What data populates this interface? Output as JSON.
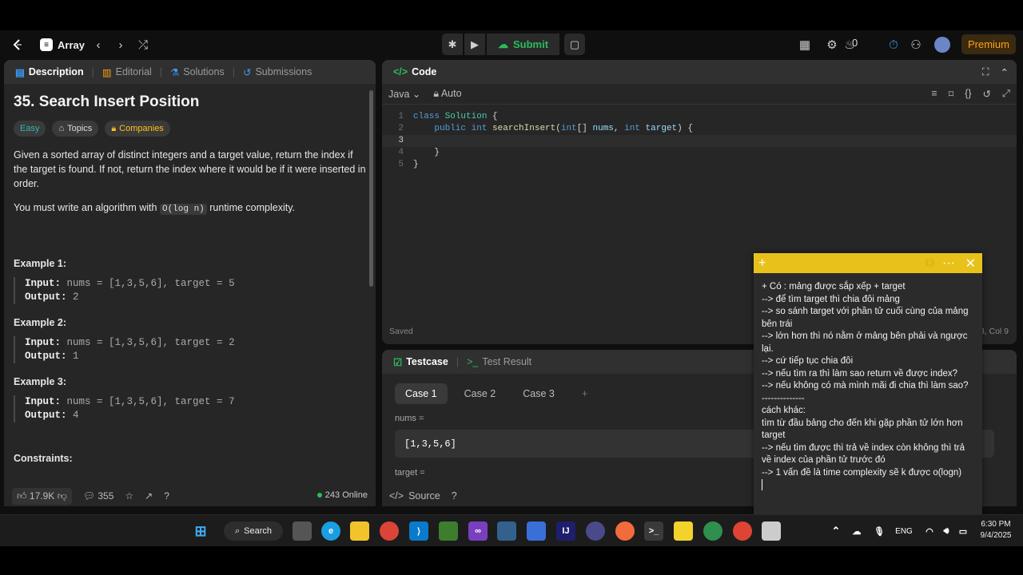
{
  "nav": {
    "problem_list": "Array",
    "submit_label": "Submit",
    "streak_count": "0",
    "premium_label": "Premium"
  },
  "description_panel": {
    "tabs": [
      "Description",
      "Editorial",
      "Solutions",
      "Submissions"
    ],
    "title": "35. Search Insert Position",
    "chips": {
      "difficulty": "Easy",
      "topics": "Topics",
      "companies": "Companies"
    },
    "paragraph1": "Given a sorted array of distinct integers and a target value, return the index if the target is found. If not, return the index where it would be if it were inserted in order.",
    "paragraph2_prefix": "You must write an algorithm with",
    "paragraph2_code": "O(log n)",
    "paragraph2_suffix": "runtime complexity.",
    "examples": [
      {
        "heading": "Example 1:",
        "input_label": "Input:",
        "input": "nums = [1,3,5,6], target = 5",
        "output_label": "Output:",
        "output": "2"
      },
      {
        "heading": "Example 2:",
        "input_label": "Input:",
        "input": "nums = [1,3,5,6], target = 2",
        "output_label": "Output:",
        "output": "1"
      },
      {
        "heading": "Example 3:",
        "input_label": "Input:",
        "input": "nums = [1,3,5,6], target = 7",
        "output_label": "Output:",
        "output": "4"
      }
    ],
    "constraints_heading": "Constraints:",
    "footer": {
      "likes": "17.9K",
      "comments": "355",
      "online": "243 Online"
    }
  },
  "code_panel": {
    "title": "Code",
    "language": "Java",
    "mode": "Auto",
    "lines": [
      "1",
      "2",
      "3",
      "4",
      "5"
    ],
    "status": "Saved",
    "cursor": "3, Col 9"
  },
  "testcase_panel": {
    "tabs": [
      "Testcase",
      "Test Result"
    ],
    "cases": [
      "Case 1",
      "Case 2",
      "Case 3"
    ],
    "fields": [
      {
        "label": "nums =",
        "value": "[1,3,5,6]"
      },
      {
        "label": "target =",
        "value": ""
      }
    ],
    "footer_source": "Source"
  },
  "sticky_note": {
    "lines": [
      "+ Có : mảng được sắp xếp + target",
      "--> để tìm target thì chia đôi mảng",
      "--> so sánh target với phần tử cuối cùng của mảng bên trái",
      "--> lớn hơn thì nó nằm ở mảng bên phải và ngược lại.",
      "--> cứ tiếp tục chia đôi",
      "--> nếu tìm ra thì làm sao return về được index?",
      "--> nếu không có mà mình mãi đi chia thì làm sao?",
      "--------------",
      "cách khác:",
      "tìm từ đầu bảng cho đến khi gặp phần tử lớn hơn target",
      "--> nếu tìm được thì trả về index còn không thì trả về index của phần tử trước đó",
      "--> 1 vấn đề là time complexity sẽ k được o(logn)"
    ]
  },
  "taskbar": {
    "search_label": "Search",
    "language": "ENG",
    "time": "6:30 PM",
    "date": "9/4/2025"
  },
  "colors": {
    "accent_green": "#2cbb5d",
    "premium": "#ffa116",
    "sticky": "#e8c21a",
    "easy": "#2cbbaa"
  }
}
